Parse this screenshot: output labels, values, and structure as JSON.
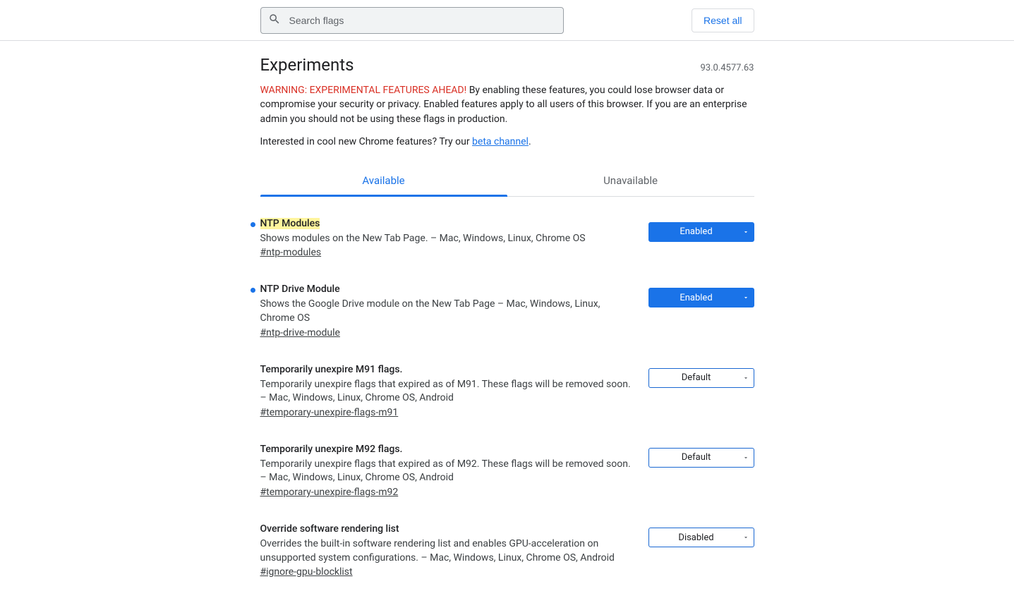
{
  "header": {
    "search_placeholder": "Search flags",
    "reset_label": "Reset all"
  },
  "page": {
    "title": "Experiments",
    "version": "93.0.4577.63",
    "warning_prefix": "WARNING: EXPERIMENTAL FEATURES AHEAD!",
    "warning_body": " By enabling these features, you could lose browser data or compromise your security or privacy. Enabled features apply to all users of this browser. If you are an enterprise admin you should not be using these flags in production.",
    "interest_prefix": "Interested in cool new Chrome features? Try our ",
    "interest_link": "beta channel",
    "interest_suffix": "."
  },
  "tabs": {
    "available": "Available",
    "unavailable": "Unavailable"
  },
  "flags": [
    {
      "title": "NTP Modules",
      "highlighted": true,
      "modified": true,
      "desc": "Shows modules on the New Tab Page. – Mac, Windows, Linux, Chrome OS",
      "hash": "#ntp-modules",
      "value": "Enabled",
      "value_style": "enabled"
    },
    {
      "title": "NTP Drive Module",
      "highlighted": false,
      "modified": true,
      "desc": "Shows the Google Drive module on the New Tab Page – Mac, Windows, Linux, Chrome OS",
      "hash": "#ntp-drive-module",
      "value": "Enabled",
      "value_style": "enabled"
    },
    {
      "title": "Temporarily unexpire M91 flags.",
      "highlighted": false,
      "modified": false,
      "desc": "Temporarily unexpire flags that expired as of M91. These flags will be removed soon. – Mac, Windows, Linux, Chrome OS, Android",
      "hash": "#temporary-unexpire-flags-m91",
      "value": "Default",
      "value_style": "default"
    },
    {
      "title": "Temporarily unexpire M92 flags.",
      "highlighted": false,
      "modified": false,
      "desc": "Temporarily unexpire flags that expired as of M92. These flags will be removed soon. – Mac, Windows, Linux, Chrome OS, Android",
      "hash": "#temporary-unexpire-flags-m92",
      "value": "Default",
      "value_style": "default"
    },
    {
      "title": "Override software rendering list",
      "highlighted": false,
      "modified": false,
      "desc": "Overrides the built-in software rendering list and enables GPU-acceleration on unsupported system configurations. – Mac, Windows, Linux, Chrome OS, Android",
      "hash": "#ignore-gpu-blocklist",
      "value": "Disabled",
      "value_style": "default"
    }
  ]
}
